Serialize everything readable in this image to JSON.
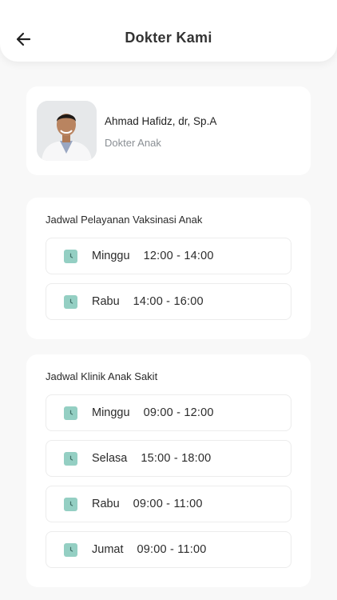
{
  "header": {
    "title": "Dokter Kami"
  },
  "doctor": {
    "name": "Ahmad Hafidz, dr, Sp.A",
    "specialty": "Dokter Anak"
  },
  "vaccination": {
    "title": "Jadwal Pelayanan Vaksinasi Anak",
    "slots": [
      {
        "day": "Minggu",
        "time": "12:00 - 14:00"
      },
      {
        "day": "Rabu",
        "time": "14:00 - 16:00"
      }
    ]
  },
  "sick_clinic": {
    "title": "Jadwal Klinik Anak Sakit",
    "slots": [
      {
        "day": "Minggu",
        "time": "09:00 - 12:00"
      },
      {
        "day": "Selasa",
        "time": "15:00 - 18:00"
      },
      {
        "day": "Rabu",
        "time": "09:00 - 11:00"
      },
      {
        "day": "Jumat",
        "time": "09:00 - 11:00"
      }
    ]
  },
  "colors": {
    "accent": "#94cfc3",
    "background": "#f8f8f8",
    "card": "#ffffff"
  },
  "icons": {
    "back": "arrow-left-icon",
    "clock": "clock-icon",
    "avatar": "doctor-photo"
  }
}
